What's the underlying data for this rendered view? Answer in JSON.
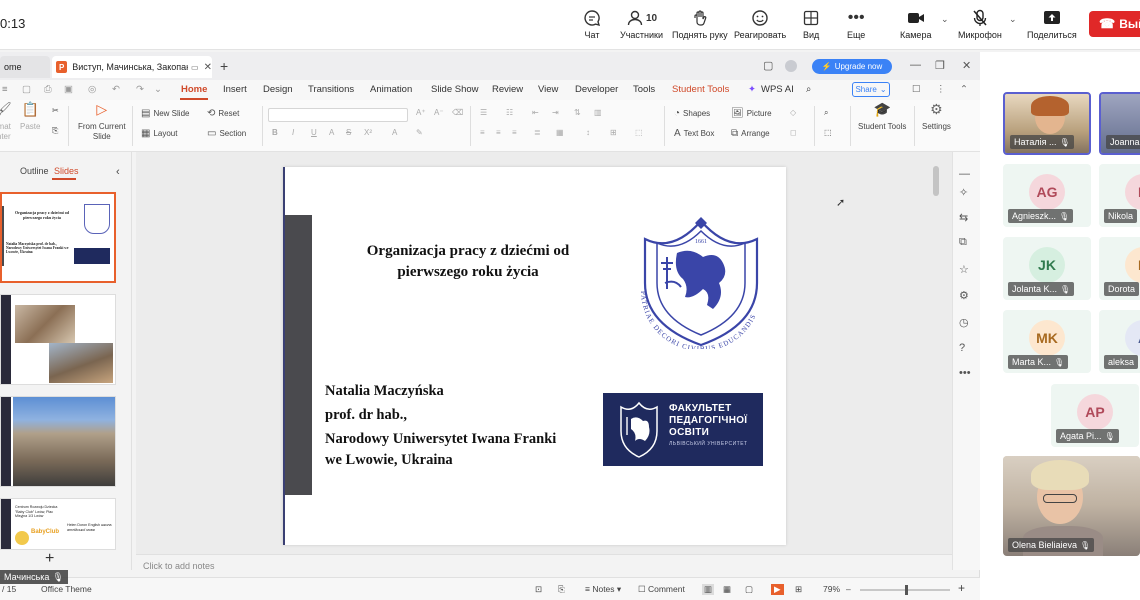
{
  "zoom": {
    "time": "0:13",
    "toolbar": {
      "chat": "Чат",
      "participants": "Участники",
      "participants_count": "10",
      "raise_hand": "Поднять руку",
      "react": "Реагировать",
      "view": "Вид",
      "more": "Еще",
      "camera": "Камера",
      "mic": "Микрофон",
      "share": "Поделиться",
      "leave": "Вый"
    }
  },
  "wps": {
    "tabs": {
      "home": "ome",
      "doc": "Виступ, Мачинська, Закопане"
    },
    "upgrade": "Upgrade now",
    "menu": [
      "Home",
      "Insert",
      "Design",
      "Transitions",
      "Animation",
      "Slide Show",
      "Review",
      "View",
      "Developer",
      "Tools",
      "Student Tools",
      "WPS AI"
    ],
    "share": "Share",
    "ribbon": {
      "format_painter_1": "rmat",
      "format_painter_2": "inter",
      "paste": "Paste",
      "from_current_1": "From Current",
      "from_current_2": "Slide",
      "new_slide": "New Slide",
      "reset": "Reset",
      "layout": "Layout",
      "section": "Section",
      "shapes": "Shapes",
      "picture": "Picture",
      "text_box": "Text Box",
      "arrange": "Arrange",
      "student_tools": "Student Tools",
      "settings": "Settings"
    },
    "left_panel": {
      "outline": "Outline",
      "slides": "Slides",
      "thumb1_title": "Organizacja pracy z dziećmi od pierwszego roku życia",
      "thumb1_author": "Natalia Maczyńska prof. dr hab., Narodowy Uniwersytet Iwana Franki we Lwowie, Ukraina",
      "thumb4_text": "Centrum Rozwoju Dziecka \"Baby Club\" Lwów, Plac Misyjna 1/3 Lwów",
      "thumb4_text2": "Helen Doron English школа англійської мови",
      "thumb4_logo": "BabyClub"
    },
    "slide": {
      "title": "Organizacja pracy z dziećmi od pierwszego roku życia",
      "author_name": "Natalia Maczyńska",
      "author_title": "prof. dr hab.,",
      "university_1": "Narodowy Uniwersytet Iwana Franki",
      "university_2": "we Lwowie, Ukraina",
      "crest_year": "1661",
      "crest_motto": "PATRIAE DECORI CIVIBUS EDUCANDIS",
      "faculty_1": "ФАКУЛЬТЕТ",
      "faculty_2": "ПЕДАГОГІЧНОЇ",
      "faculty_3": "ОСВІТИ",
      "faculty_sub": "ЛЬВІВСЬКИЙ УНІВЕРСИТЕТ"
    },
    "notes_placeholder": "Click to add notes",
    "status": {
      "slide_count": "/ 15",
      "theme": "Office Theme",
      "notes": "Notes",
      "comment": "Comment",
      "zoom": "79%"
    },
    "speaker": "Мачинська"
  },
  "participants": [
    {
      "name": "Наталія ...",
      "video": true,
      "active": true
    },
    {
      "name": "Joanna",
      "video": true,
      "active": true
    },
    {
      "name": "Agnieszk...",
      "initials": "AG",
      "color": "#f5d7dc",
      "text_color": "#b04a5a"
    },
    {
      "name": "Nikola",
      "initials": "N",
      "color": "#f5d7dc",
      "text_color": "#b04a5a"
    },
    {
      "name": "Jolanta K...",
      "initials": "JK",
      "color": "#d6efe0",
      "text_color": "#2f7a4d"
    },
    {
      "name": "Dorota",
      "initials": "D",
      "color": "#fde7cf",
      "text_color": "#a86a20"
    },
    {
      "name": "Marta K...",
      "initials": "MK",
      "color": "#fde7cf",
      "text_color": "#a86a20"
    },
    {
      "name": "aleksa",
      "initials": "A",
      "color": "#e4e8f5",
      "text_color": "#4a5a90"
    },
    {
      "name": "Agata Pi...",
      "initials": "AP",
      "color": "#f5d7dc",
      "text_color": "#b04a5a"
    },
    {
      "name": "Olena Bieliaieva",
      "video": true
    }
  ]
}
